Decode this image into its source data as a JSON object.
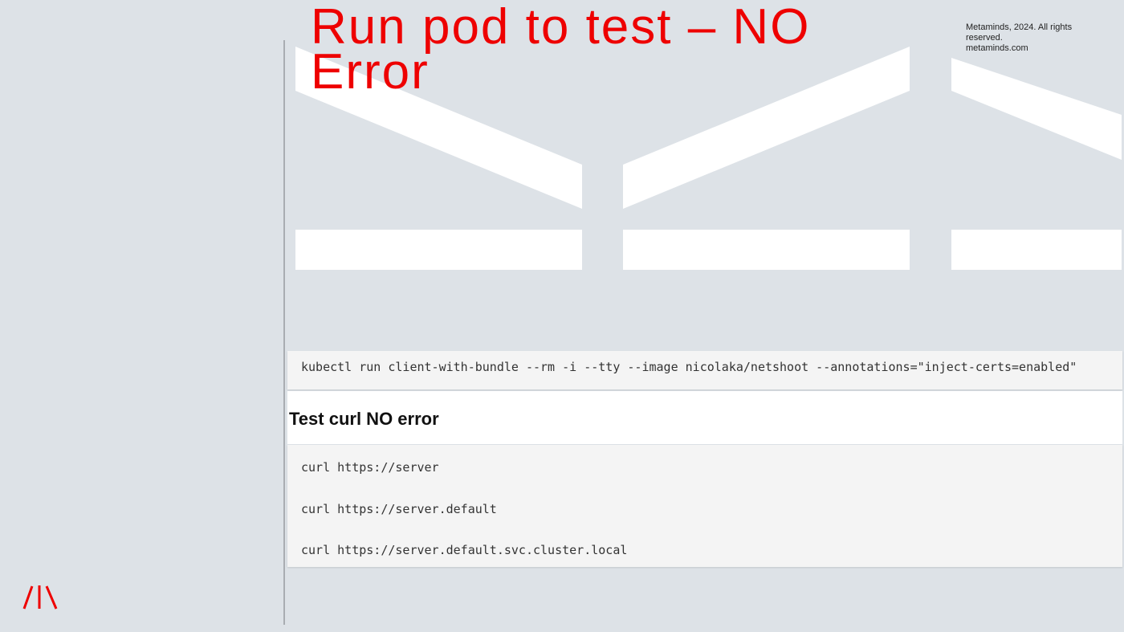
{
  "title": "Run pod to test – NO Error",
  "copyright": {
    "line1": "Metaminds, 2024. All rights reserved.",
    "line2": "metaminds.com"
  },
  "run_command": "kubectl run client-with-bundle --rm -i --tty --image nicolaka/netshoot --annotations=\"inject-certs=enabled\"",
  "section": {
    "heading": "Test curl NO error"
  },
  "curl_commands": [
    "curl https://server",
    "curl https://server.default",
    "curl https://server.default.svc.cluster.local"
  ],
  "colors": {
    "accent": "#ee0000",
    "background": "#dde2e7",
    "code_background": "#f4f4f4"
  },
  "logo": {
    "icon": "metaminds-logo-icon"
  }
}
